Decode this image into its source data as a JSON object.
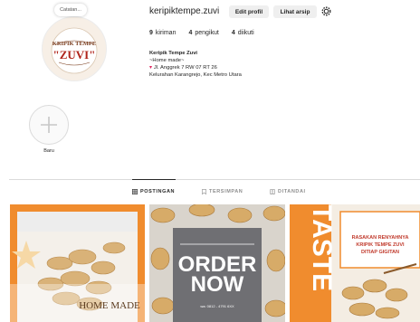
{
  "avatar": {
    "note": "Catatan...",
    "logo_line1": "KRIPIK TEMPE",
    "logo_line2": "\"ZUVI\""
  },
  "header": {
    "username": "keripiktempe.zuvi",
    "edit_profile_label": "Edit profil",
    "archive_label": "Lihat arsip"
  },
  "stats": [
    {
      "count": "9",
      "label": "kiriman"
    },
    {
      "count": "4",
      "label": "pengikut"
    },
    {
      "count": "4",
      "label": "diikuti"
    }
  ],
  "bio": {
    "name": "Keripik Tempe Zuvi",
    "tagline": "~Home made~",
    "address": "Jl. Anggrek 7 RW 07 RT 26",
    "area": "Kelurahan Karangrejo, Kec Metro Utara"
  },
  "highlight": {
    "label": "Baru"
  },
  "tabs": {
    "posts": "POSTINGAN",
    "saved": "TERSIMPAN",
    "tagged": "DITANDAI"
  },
  "posts": [
    {
      "caption": "HOME MADE"
    },
    {
      "line1": "ORDER",
      "line2": "NOW",
      "contact": "wa: 0812 - 4791 6XX"
    },
    {
      "side_text": "TASTE",
      "line1": "RASAKAN RENYAHNYA",
      "line2": "KRIPIK TEMPE ZUVI",
      "line3": "DITIAP GIGITAN"
    }
  ],
  "colors": {
    "text": "#262626",
    "muted": "#8e8e8e",
    "button_bg": "#efefef",
    "orange": "#f08c2e",
    "gray_panel": "#6f6f73",
    "pin": "#e0245e"
  },
  "icons": [
    "gear-icon",
    "plus-icon",
    "grid-icon",
    "bookmark-icon",
    "tag-icon",
    "location-pin-icon"
  ]
}
